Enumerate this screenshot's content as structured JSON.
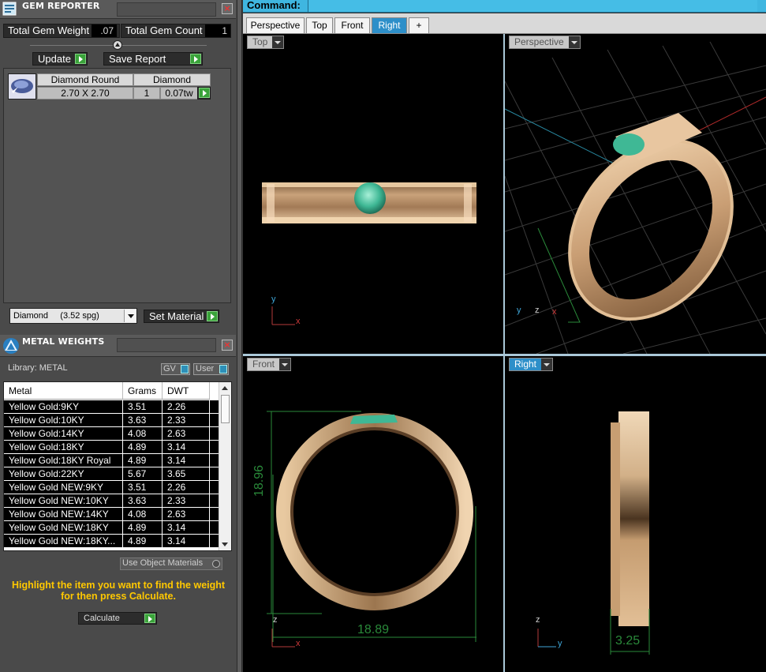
{
  "gem_reporter": {
    "title": "GEM REPORTER",
    "total_gem_weight_label": "Total Gem Weight",
    "total_gem_weight_value": ".07",
    "total_gem_count_label": "Total Gem Count",
    "total_gem_count_value": "1",
    "update_label": "Update",
    "save_report_label": "Save Report",
    "gem_table": {
      "headers": [
        "Diamond Round",
        "Diamond"
      ],
      "row": {
        "size": "2.70 X 2.70",
        "count": "1",
        "weight": "0.07tw"
      }
    },
    "material_dropdown": "Diamond     (3.52 spg)",
    "set_material_label": "Set Material"
  },
  "metal_weights": {
    "title": "METAL WEIGHTS",
    "library_label": "Library: METAL",
    "gv_toggle": "GV",
    "user_toggle": "User",
    "columns": [
      "Metal",
      "Grams",
      "DWT"
    ],
    "rows": [
      {
        "metal": "Yellow Gold:9KY",
        "grams": "3.51",
        "dwt": "2.26"
      },
      {
        "metal": "Yellow Gold:10KY",
        "grams": "3.63",
        "dwt": "2.33"
      },
      {
        "metal": "Yellow Gold:14KY",
        "grams": "4.08",
        "dwt": "2.63"
      },
      {
        "metal": "Yellow Gold:18KY",
        "grams": "4.89",
        "dwt": "3.14"
      },
      {
        "metal": "Yellow Gold:18KY Royal",
        "grams": "4.89",
        "dwt": "3.14"
      },
      {
        "metal": "Yellow Gold:22KY",
        "grams": "5.67",
        "dwt": "3.65"
      },
      {
        "metal": "Yellow Gold NEW:9KY",
        "grams": "3.51",
        "dwt": "2.26"
      },
      {
        "metal": "Yellow Gold NEW:10KY",
        "grams": "3.63",
        "dwt": "2.33"
      },
      {
        "metal": "Yellow Gold NEW:14KY",
        "grams": "4.08",
        "dwt": "2.63"
      },
      {
        "metal": "Yellow Gold NEW:18KY",
        "grams": "4.89",
        "dwt": "3.14"
      },
      {
        "metal": "Yellow Gold NEW:18KY...",
        "grams": "4.89",
        "dwt": "3.14"
      }
    ],
    "use_object_materials": "Use Object Materials",
    "hint": "Highlight the item you want to find the weight for then press Calculate.",
    "calculate_label": "Calculate"
  },
  "command": {
    "label": "Command:"
  },
  "tabs": [
    {
      "label": "Perspective",
      "active": false
    },
    {
      "label": "Top",
      "active": false
    },
    {
      "label": "Front",
      "active": false
    },
    {
      "label": "Right",
      "active": true
    },
    {
      "label": "+",
      "active": false
    }
  ],
  "viewports": {
    "top": {
      "label": "Top",
      "axis_y": "y",
      "axis_x": "x"
    },
    "perspective": {
      "label": "Perspective",
      "axis_y": "y",
      "axis_z": "z",
      "axis_x": "x"
    },
    "front": {
      "label": "Front",
      "dim_height": "18.96",
      "dim_width": "18.89",
      "axis_z": "z",
      "axis_x": "x"
    },
    "right": {
      "label": "Right",
      "dim_width": "3.25",
      "axis_z": "z",
      "axis_y": "y"
    }
  },
  "colors": {
    "accent": "#2d8fc9",
    "command_bar": "#3fb6e0",
    "hint": "#ffc800",
    "dimension": "#2a8a3a",
    "gold": "#d9b48a",
    "gem": "#3fbf9a"
  }
}
